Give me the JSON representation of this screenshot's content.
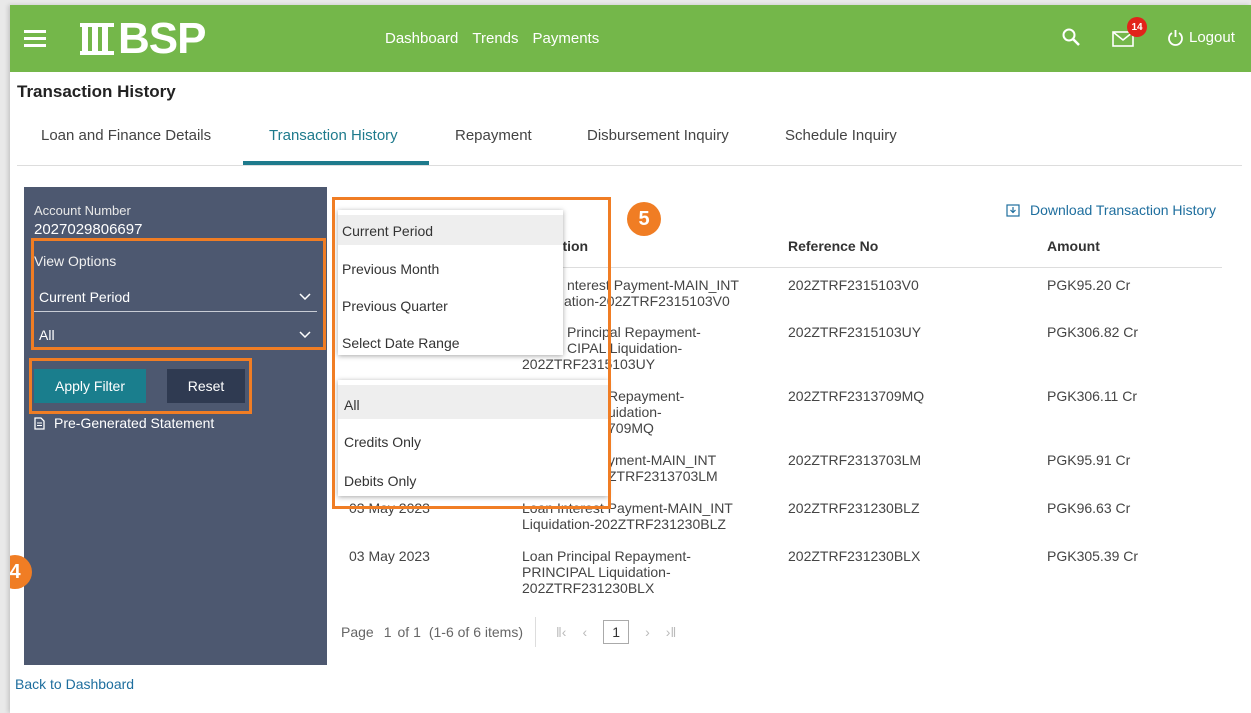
{
  "header": {
    "logo_text": "BSP",
    "nav": [
      "Dashboard",
      "Trends",
      "Payments"
    ],
    "mail_badge": "14",
    "logout_label": "Logout",
    "brand_color": "#74b74a"
  },
  "page_title": "Transaction History",
  "tabs": [
    "Loan and Finance Details",
    "Transaction History",
    "Repayment",
    "Disbursement Inquiry",
    "Schedule Inquiry"
  ],
  "sidebar": {
    "account_label": "Account Number",
    "account_number": "2027029806697",
    "view_options_label": "View Options",
    "period_value": "Current Period",
    "type_value": "All",
    "apply_label": "Apply Filter",
    "reset_label": "Reset",
    "pregen_label": "Pre-Generated Statement"
  },
  "steps": {
    "five": "5",
    "four": "4"
  },
  "period_menu": [
    "Current Period",
    "Previous Month",
    "Previous Quarter",
    "Select Date Range"
  ],
  "type_menu": [
    "All",
    "Credits Only",
    "Debits Only"
  ],
  "download_label": "Download Transaction History",
  "table": {
    "headers": {
      "description_partial": "iption",
      "reference": "Reference No",
      "amount": "Amount"
    },
    "rows": [
      {
        "date": "",
        "desc": "nterest Payment-MAIN_INT",
        "desc2": "ation-202ZTRF2315103V0",
        "desc3": "",
        "ref": "202ZTRF2315103V0",
        "amt": "PGK95.20 Cr"
      },
      {
        "date": "",
        "desc": "Principal Repayment-",
        "desc2": "CIPAL Liquidation-",
        "desc3": "202ZTRF2315103UY",
        "ref": "202ZTRF2315103UY",
        "amt": "PGK306.82 Cr"
      },
      {
        "date": "",
        "desc": "Repayment-",
        "desc2": "uidation-",
        "desc3": "709MQ",
        "ref": "202ZTRF2313709MQ",
        "amt": "PGK306.11 Cr"
      },
      {
        "date": "",
        "desc": "yment-MAIN_INT",
        "desc2": "ZTRF2313703LM",
        "desc3": "",
        "ref": "202ZTRF2313703LM",
        "amt": "PGK95.91 Cr"
      },
      {
        "date": "03 May 2023",
        "desc": "Loan Interest Payment-MAIN_INT",
        "desc2": "Liquidation-202ZTRF231230BLZ",
        "desc3": "",
        "ref": "202ZTRF231230BLZ",
        "amt": "PGK96.63 Cr"
      },
      {
        "date": "03 May 2023",
        "desc": "Loan Principal Repayment-",
        "desc2": "PRINCIPAL Liquidation-",
        "desc3": "202ZTRF231230BLX",
        "ref": "202ZTRF231230BLX",
        "amt": "PGK305.39 Cr"
      }
    ]
  },
  "pager": {
    "page_label": "Page",
    "current": "1",
    "of": "of 1",
    "items": "(1-6 of 6 items)"
  },
  "back_label": "Back to Dashboard"
}
